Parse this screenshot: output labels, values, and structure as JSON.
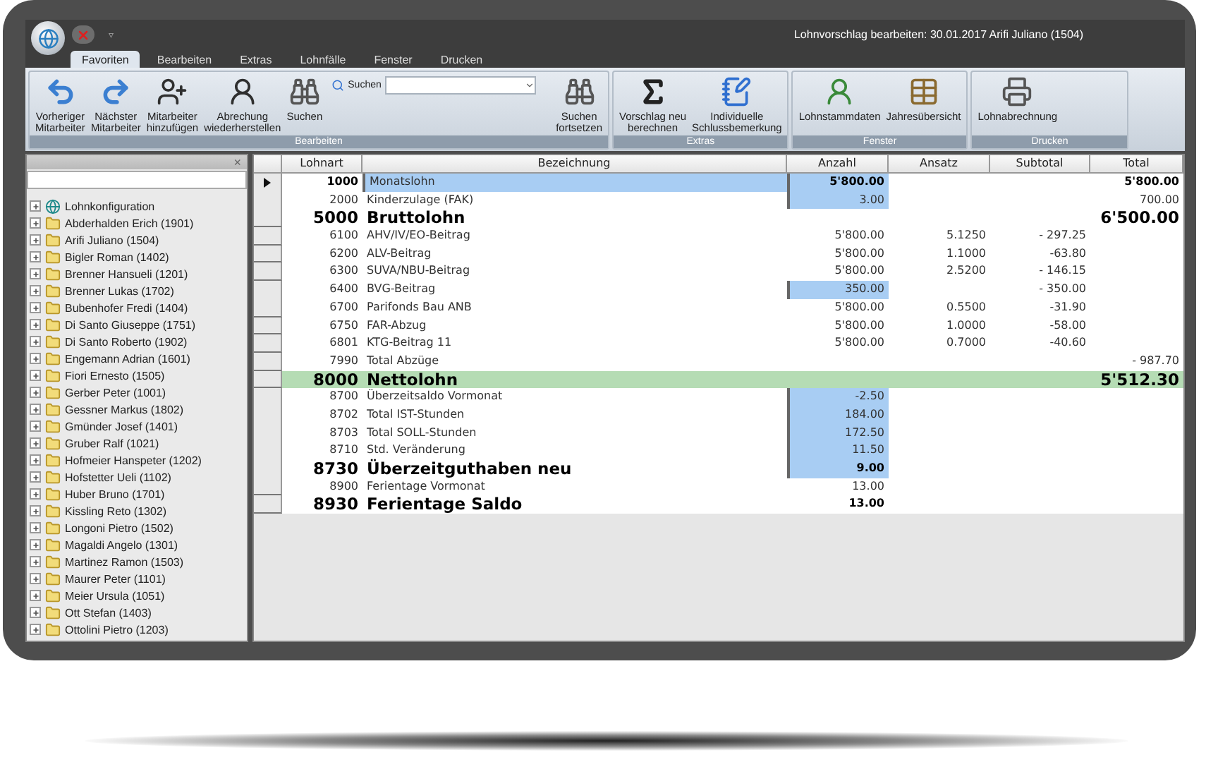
{
  "window": {
    "title": "Lohnvorschlag bearbeiten: 30.01.2017 Arifi Juliano (1504)"
  },
  "quick_access": {
    "menu_glyph": "▿"
  },
  "tabs": [
    {
      "label": "Favoriten",
      "selected": true
    },
    {
      "label": "Bearbeiten",
      "selected": false
    },
    {
      "label": "Extras",
      "selected": false
    },
    {
      "label": "Lohnfälle",
      "selected": false
    },
    {
      "label": "Fenster",
      "selected": false
    },
    {
      "label": "Drucken",
      "selected": false
    }
  ],
  "ribbon": {
    "groups": [
      {
        "label": "Bearbeiten",
        "buttons": [
          {
            "label": "Vorheriger\nMitarbeiter"
          },
          {
            "label": "Nächster\nMitarbeiter"
          },
          {
            "label": "Mitarbeiter\nhinzufügen"
          },
          {
            "label": "Abrechung\nwiederherstellen"
          },
          {
            "label": "Suchen"
          }
        ],
        "search": {
          "label": "Suchen"
        },
        "end_button": {
          "label": "Suchen\nfortsetzen"
        }
      },
      {
        "label": "Extras",
        "buttons": [
          {
            "label": "Vorschlag neu\nberechnen"
          },
          {
            "label": "Individuelle\nSchlussbemerkung"
          }
        ]
      },
      {
        "label": "Fenster",
        "buttons": [
          {
            "label": "Lohnstammdaten"
          },
          {
            "label": "Jahresübersicht"
          }
        ]
      },
      {
        "label": "Drucken",
        "buttons": [
          {
            "label": "Lohnabrechnung"
          }
        ]
      }
    ]
  },
  "sidebar": {
    "close": "×",
    "items": [
      {
        "label": "Lohnkonfiguration",
        "kind": "config"
      },
      {
        "label": "Abderhalden Erich (1901)",
        "kind": "folder"
      },
      {
        "label": "Arifi Juliano (1504)",
        "kind": "folder"
      },
      {
        "label": "Bigler Roman (1402)",
        "kind": "folder"
      },
      {
        "label": "Brenner Hansueli (1201)",
        "kind": "folder"
      },
      {
        "label": "Brenner Lukas (1702)",
        "kind": "folder"
      },
      {
        "label": "Bubenhofer Fredi (1404)",
        "kind": "folder"
      },
      {
        "label": "Di Santo Giuseppe (1751)",
        "kind": "folder"
      },
      {
        "label": "Di Santo Roberto (1902)",
        "kind": "folder"
      },
      {
        "label": "Engemann Adrian (1601)",
        "kind": "folder"
      },
      {
        "label": "Fiori Ernesto (1505)",
        "kind": "folder"
      },
      {
        "label": "Gerber Peter (1001)",
        "kind": "folder"
      },
      {
        "label": "Gessner Markus (1802)",
        "kind": "folder"
      },
      {
        "label": "Gmünder Josef (1401)",
        "kind": "folder"
      },
      {
        "label": "Gruber Ralf (1021)",
        "kind": "folder"
      },
      {
        "label": "Hofmeier Hanspeter (1202)",
        "kind": "folder"
      },
      {
        "label": "Hofstetter Ueli (1102)",
        "kind": "folder"
      },
      {
        "label": "Huber Bruno (1701)",
        "kind": "folder"
      },
      {
        "label": "Kissling Reto (1302)",
        "kind": "folder"
      },
      {
        "label": "Longoni Pietro (1502)",
        "kind": "folder"
      },
      {
        "label": "Magaldi Angelo (1301)",
        "kind": "folder"
      },
      {
        "label": "Martinez Ramon (1503)",
        "kind": "folder"
      },
      {
        "label": "Maurer Peter (1101)",
        "kind": "folder"
      },
      {
        "label": "Meier Ursula (1051)",
        "kind": "folder"
      },
      {
        "label": "Ott Stefan (1403)",
        "kind": "folder"
      },
      {
        "label": "Ottolini Pietro (1203)",
        "kind": "folder"
      }
    ]
  },
  "table": {
    "columns": [
      "Lohnart",
      "Bezeichnung",
      "Anzahl",
      "Ansatz",
      "Subtotal",
      "Total"
    ],
    "rows": [
      {
        "code": "1000",
        "label": "Monatslohn",
        "anzahl": "5'800.00",
        "total": "5'800.00",
        "kind": "item",
        "editable": true,
        "selected": true
      },
      {
        "code": "2000",
        "label": "Kinderzulage (FAK)",
        "anzahl": "3.00",
        "total": "700.00",
        "kind": "item",
        "editable": true,
        "selected": false
      },
      {
        "code": "5000",
        "label": "Bruttolohn",
        "total": "6'500.00",
        "kind": "sum",
        "editable": false,
        "selected": false
      },
      {
        "code": "6100",
        "label": "AHV/IV/EO-Beitrag",
        "anzahl": "5'800.00",
        "ansatz": "5.1250",
        "subtotal": "- 297.25",
        "kind": "item",
        "editable": false,
        "selected": false
      },
      {
        "code": "6200",
        "label": "ALV-Beitrag",
        "anzahl": "5'800.00",
        "ansatz": "1.1000",
        "subtotal": "-63.80",
        "kind": "item",
        "editable": false,
        "selected": false
      },
      {
        "code": "6300",
        "label": "SUVA/NBU-Beitrag",
        "anzahl": "5'800.00",
        "ansatz": "2.5200",
        "subtotal": "- 146.15",
        "kind": "item",
        "editable": false,
        "selected": false
      },
      {
        "code": "6400",
        "label": "BVG-Beitrag",
        "anzahl": "350.00",
        "subtotal": "- 350.00",
        "kind": "item",
        "editable": true,
        "selected": false
      },
      {
        "code": "6700",
        "label": "Parifonds Bau ANB",
        "anzahl": "5'800.00",
        "ansatz": "0.5500",
        "subtotal": "-31.90",
        "kind": "item",
        "editable": false,
        "selected": false
      },
      {
        "code": "6750",
        "label": "FAR-Abzug",
        "anzahl": "5'800.00",
        "ansatz": "1.0000",
        "subtotal": "-58.00",
        "kind": "item",
        "editable": false,
        "selected": false
      },
      {
        "code": "6801",
        "label": "KTG-Beitrag 11",
        "anzahl": "5'800.00",
        "ansatz": "0.7000",
        "subtotal": "-40.60",
        "kind": "item",
        "editable": false,
        "selected": false
      },
      {
        "code": "7990",
        "label": "Total Abzüge",
        "total": "- 987.70",
        "kind": "item",
        "editable": false,
        "selected": false
      },
      {
        "code": "8000",
        "label": "Nettolohn",
        "total": "5'512.30",
        "kind": "net",
        "editable": false,
        "selected": false
      },
      {
        "code": "8700",
        "label": "Überzeitsaldo Vormonat",
        "anzahl": "-2.50",
        "kind": "item",
        "editable": true,
        "selected": false
      },
      {
        "code": "8702",
        "label": "Total IST-Stunden",
        "anzahl": "184.00",
        "kind": "item",
        "editable": true,
        "selected": false
      },
      {
        "code": "8703",
        "label": "Total SOLL-Stunden",
        "anzahl": "172.50",
        "kind": "item",
        "editable": true,
        "selected": false
      },
      {
        "code": "8710",
        "label": "Std. Veränderung",
        "anzahl": "11.50",
        "kind": "item",
        "editable": true,
        "selected": false
      },
      {
        "code": "8730",
        "label": "Überzeitguthaben neu",
        "anzahl": "9.00",
        "kind": "sum",
        "editable": true,
        "selected": false
      },
      {
        "code": "8900",
        "label": "Ferientage Vormonat",
        "anzahl": "13.00",
        "kind": "item",
        "editable": false,
        "selected": false
      },
      {
        "code": "8930",
        "label": "Ferientage Saldo",
        "anzahl": "13.00",
        "kind": "sum",
        "editable": false,
        "selected": false
      }
    ]
  }
}
